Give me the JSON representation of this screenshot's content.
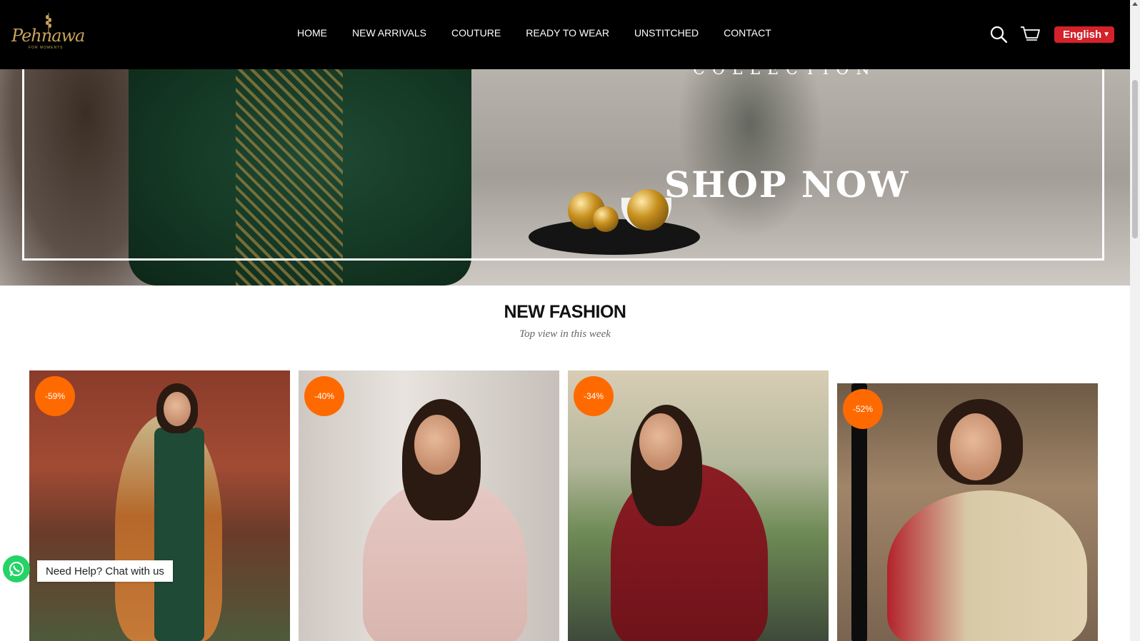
{
  "header": {
    "logo_text": "Pehnawa",
    "logo_tagline": "FOR MOMENTS",
    "nav": [
      "HOME",
      "NEW ARRIVALS",
      "COUTURE",
      "READY TO WEAR",
      "UNSTITCHED",
      "CONTACT"
    ],
    "language": "English"
  },
  "hero": {
    "collection_text": "COLLECTION",
    "cta": "SHOP NOW"
  },
  "section": {
    "title": "NEW FASHION",
    "subtitle": "Top view in this week"
  },
  "products": [
    {
      "badge": "-59%"
    },
    {
      "badge": "-40%"
    },
    {
      "badge": "-34%"
    },
    {
      "badge": "-52%"
    }
  ],
  "chat": {
    "label": "Need Help? Chat with us"
  },
  "colors": {
    "header_bg": "#000000",
    "accent_red": "#d3222a",
    "badge_orange": "#ff6a00",
    "logo_gold": "#c9a35a",
    "whatsapp_green": "#25d366"
  }
}
